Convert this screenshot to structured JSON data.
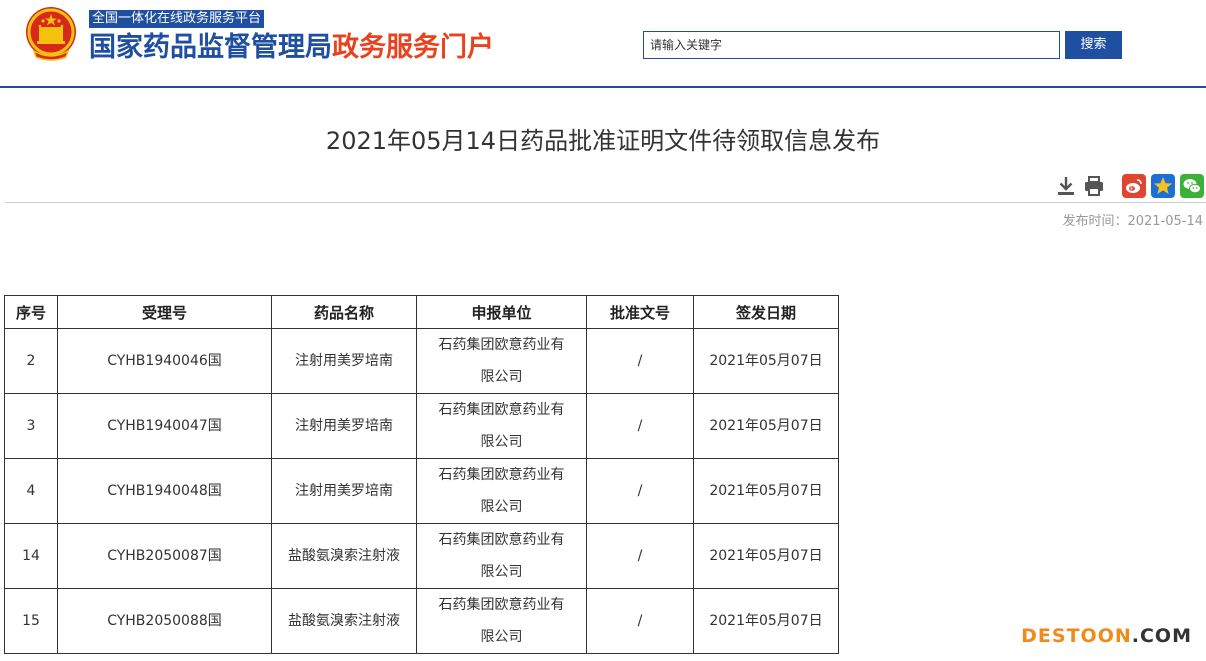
{
  "header": {
    "platform_tag": "全国一体化在线政务服务平台",
    "title_blue": "国家药品监督管理局",
    "title_red": "政务服务门户",
    "search_placeholder": "请输入关键字",
    "search_label": "搜索",
    "colors": {
      "brand_blue": "#1f4fa0",
      "brand_red": "#e8421e"
    }
  },
  "article": {
    "title": "2021年05月14日药品批准证明文件待领取信息发布",
    "publish_time": "发布时间：2021-05-14"
  },
  "tools": {
    "icons": [
      "download-icon",
      "print-icon",
      "weibo-icon",
      "qzone-icon",
      "wechat-icon"
    ]
  },
  "table": {
    "headers": [
      "序号",
      "受理号",
      "药品名称",
      "申报单位",
      "批准文号",
      "签发日期"
    ],
    "rows": [
      {
        "no": "2",
        "accept_no": "CYHB1940046国",
        "drug": "注射用美罗培南",
        "unit_line1": "石药集团欧意药业有",
        "unit_line2": "限公司",
        "approval": "/",
        "date": "2021年05月07日"
      },
      {
        "no": "3",
        "accept_no": "CYHB1940047国",
        "drug": "注射用美罗培南",
        "unit_line1": "石药集团欧意药业有",
        "unit_line2": "限公司",
        "approval": "/",
        "date": "2021年05月07日"
      },
      {
        "no": "4",
        "accept_no": "CYHB1940048国",
        "drug": "注射用美罗培南",
        "unit_line1": "石药集团欧意药业有",
        "unit_line2": "限公司",
        "approval": "/",
        "date": "2021年05月07日"
      },
      {
        "no": "14",
        "accept_no": "CYHB2050087国",
        "drug": "盐酸氨溴索注射液",
        "unit_line1": "石药集团欧意药业有",
        "unit_line2": "限公司",
        "approval": "/",
        "date": "2021年05月07日"
      },
      {
        "no": "15",
        "accept_no": "CYHB2050088国",
        "drug": "盐酸氨溴索注射液",
        "unit_line1": "石药集团欧意药业有",
        "unit_line2": "限公司",
        "approval": "/",
        "date": "2021年05月07日"
      }
    ]
  },
  "watermark": {
    "part1": "DESTOON",
    "part2": ".COM"
  }
}
